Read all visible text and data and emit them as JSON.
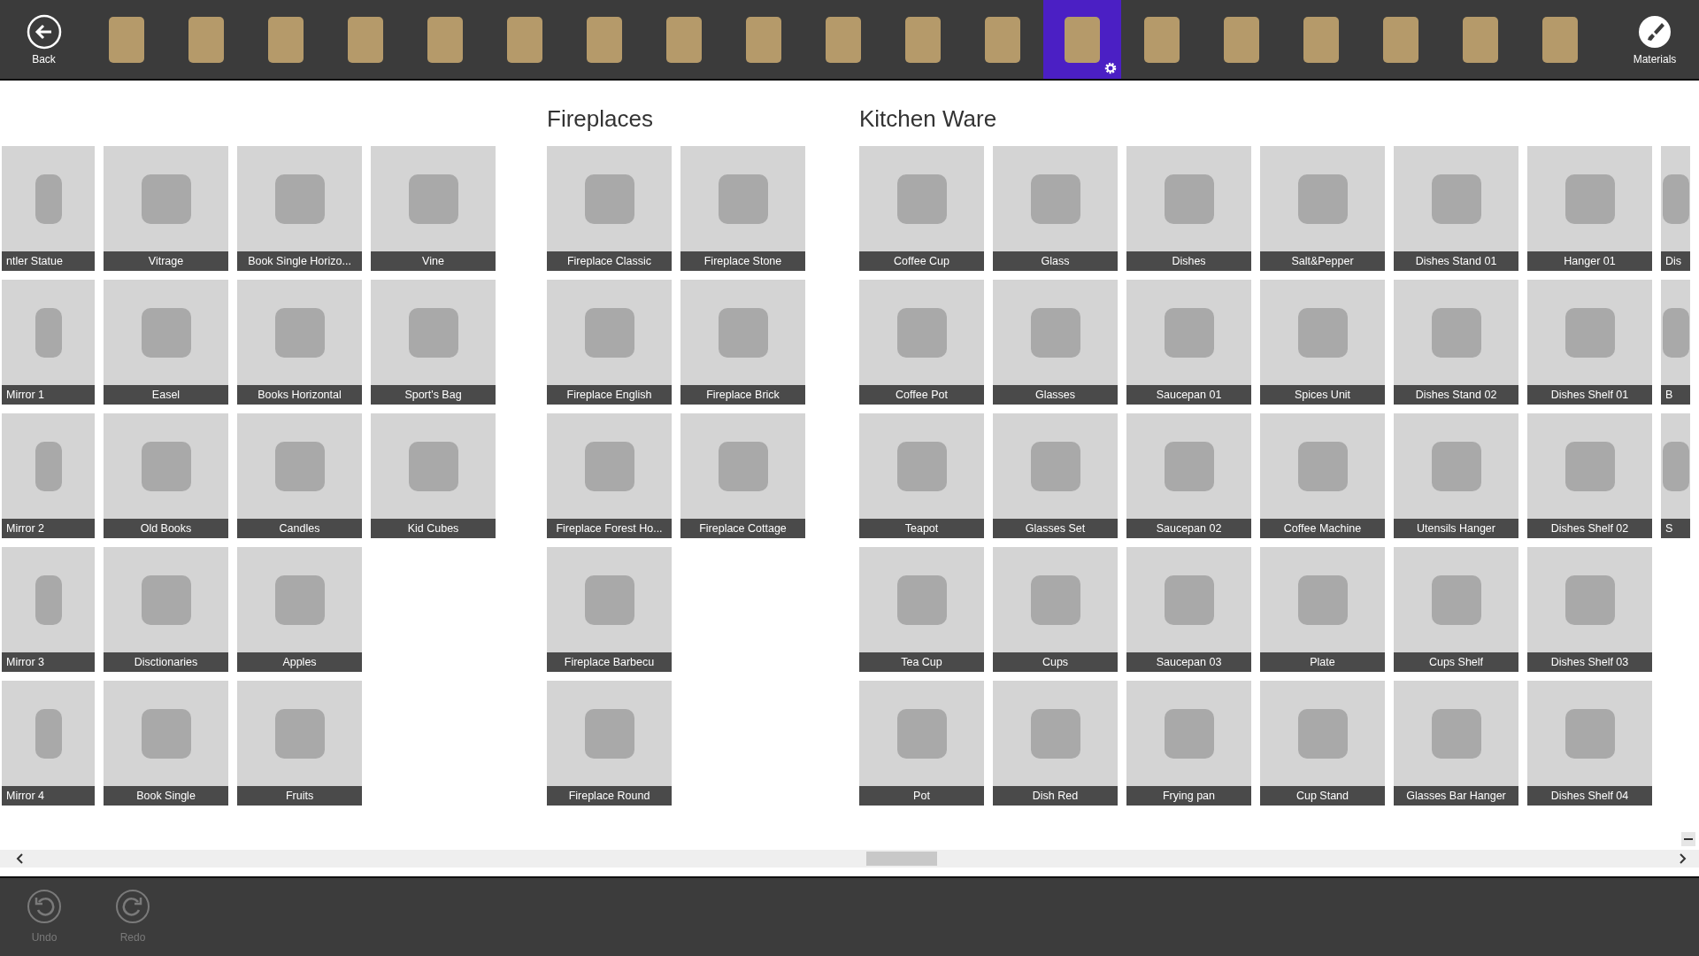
{
  "toolbar": {
    "back": {
      "label": "Back"
    },
    "categories": [
      {
        "selected": false
      },
      {
        "selected": false
      },
      {
        "selected": false
      },
      {
        "selected": false
      },
      {
        "selected": false
      },
      {
        "selected": false
      },
      {
        "selected": false
      },
      {
        "selected": false
      },
      {
        "selected": false
      },
      {
        "selected": false
      },
      {
        "selected": false
      },
      {
        "selected": false
      },
      {
        "selected": true
      },
      {
        "selected": false
      },
      {
        "selected": false
      },
      {
        "selected": false
      },
      {
        "selected": false
      },
      {
        "selected": false
      },
      {
        "selected": false
      }
    ],
    "materials": {
      "label": "Materials"
    }
  },
  "groups": [
    {
      "items": [
        "ntler Statue",
        "Mirror 1",
        "Mirror 2",
        "Mirror 3",
        "Mirror 4",
        "Vitrage",
        "Easel",
        "Old Books",
        "Disctionaries",
        "Book Single",
        "Book Single Horizo...",
        "Books Horizontal",
        "Candles",
        "Apples",
        "Fruits",
        "Vine",
        "Sport's Bag",
        "Kid Cubes"
      ]
    },
    {
      "title": "Fireplaces",
      "items": [
        "Fireplace Classic",
        "Fireplace English",
        "Fireplace Forest Ho...",
        "Fireplace Barbecu",
        "Fireplace Round",
        "Fireplace Stone",
        "Fireplace Brick",
        "Fireplace Cottage"
      ]
    },
    {
      "title": "Kitchen Ware",
      "items": [
        "Coffee Cup",
        "Coffee Pot",
        "Teapot",
        "Tea Cup",
        "Pot",
        "Glass",
        "Glasses",
        "Glasses Set",
        "Cups",
        "Dish Red",
        "Dishes",
        "Saucepan 01",
        "Saucepan 02",
        "Saucepan 03",
        "Frying pan",
        "Salt&Pepper",
        "Spices Unit",
        "Coffee Machine",
        "Plate",
        "Cup Stand",
        "Dishes Stand 01",
        "Dishes Stand 02",
        "Utensils Hanger",
        "Cups Shelf",
        "Glasses Bar Hanger",
        "Hanger 01",
        "Dishes Shelf 01",
        "Dishes Shelf 02",
        "Dishes Shelf 03",
        "Dishes Shelf 04",
        "Dis",
        "B",
        "S"
      ]
    }
  ],
  "bottom_bar": {
    "buttons": [
      {
        "kind": "undo",
        "label": "Undo",
        "disabled": true
      },
      {
        "kind": "redo",
        "label": "Redo",
        "disabled": true
      }
    ]
  }
}
